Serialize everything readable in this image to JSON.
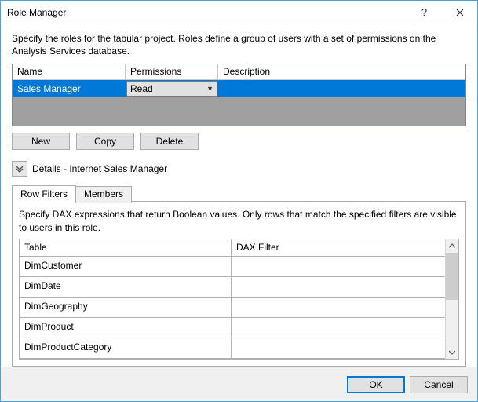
{
  "title": "Role Manager",
  "description": "Specify the roles for the tabular project. Roles define a group of users with a set of permissions on the Analysis Services database.",
  "roles_grid": {
    "headers": {
      "name": "Name",
      "permissions": "Permissions",
      "description": "Description"
    },
    "rows": [
      {
        "name": "Sales Manager",
        "permission": "Read",
        "description": ""
      }
    ]
  },
  "buttons": {
    "new": "New",
    "copy": "Copy",
    "delete": "Delete"
  },
  "details_label": "Details - Internet Sales Manager",
  "tabs": {
    "row_filters": "Row Filters",
    "members": "Members"
  },
  "row_filters": {
    "description": "Specify DAX expressions that return Boolean values. Only rows that match the specified filters are visible to users in this role.",
    "headers": {
      "table": "Table",
      "dax": "DAX Filter"
    },
    "rows": [
      {
        "table": "DimCustomer",
        "dax": ""
      },
      {
        "table": "DimDate",
        "dax": ""
      },
      {
        "table": "DimGeography",
        "dax": ""
      },
      {
        "table": "DimProduct",
        "dax": ""
      },
      {
        "table": "DimProductCategory",
        "dax": ""
      }
    ]
  },
  "footer": {
    "ok": "OK",
    "cancel": "Cancel"
  }
}
